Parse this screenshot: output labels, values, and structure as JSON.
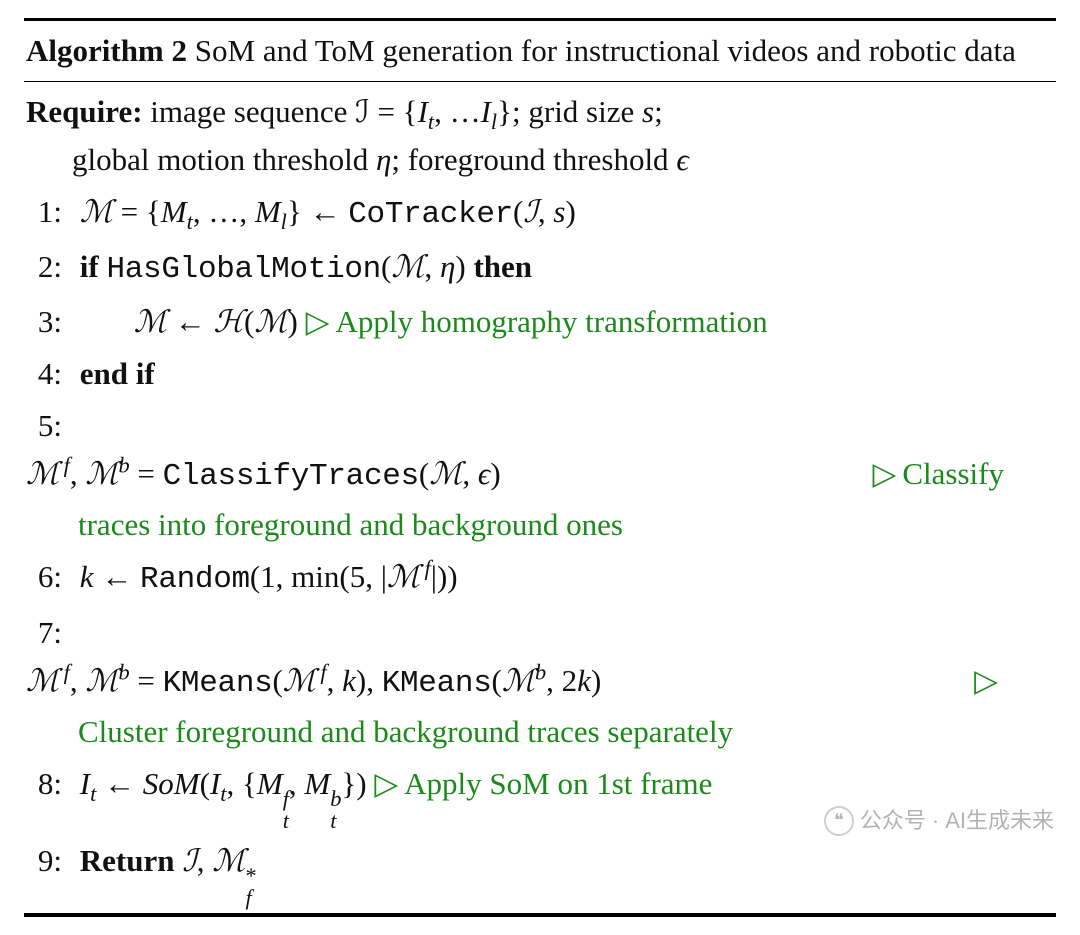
{
  "algo": {
    "label": "Algorithm 2",
    "title_rest": " SoM and ToM generation for instructional videos and robotic data",
    "require_label": "Require:",
    "require_line1_a": " image sequence ℐ  =  {",
    "require_line1_b": "}; grid size ",
    "require_line1_c": ";",
    "require_line2_a": "global motion threshold ",
    "require_line2_b": "; foreground threshold ",
    "ln1": "1:",
    "l1_cotracker": "CoTracker",
    "ln2": "2:",
    "l2_if": "if",
    "l2_hasglobal": "HasGlobalMotion",
    "l2_then": "then",
    "ln3": "3:",
    "l3_comment": "Apply homography transformation",
    "ln4": "4:",
    "l4_endif": "end if",
    "ln5": "5:",
    "l5_classify": "ClassifyTraces",
    "l5_comment_a": "Classify",
    "l5_comment_b": "traces into foreground and background ones",
    "ln6": "6:",
    "l6_random": "Random",
    "ln7": "7:",
    "l7_kmeans": "KMeans",
    "l7_comment": "Cluster foreground and background traces separately",
    "ln8": "8:",
    "l8_comment": "Apply SoM on 1st frame",
    "ln9": "9:",
    "l9_return": "Return"
  },
  "watermark": {
    "prefix": "公众号",
    "sep": "·",
    "name": "AI生成未来"
  }
}
